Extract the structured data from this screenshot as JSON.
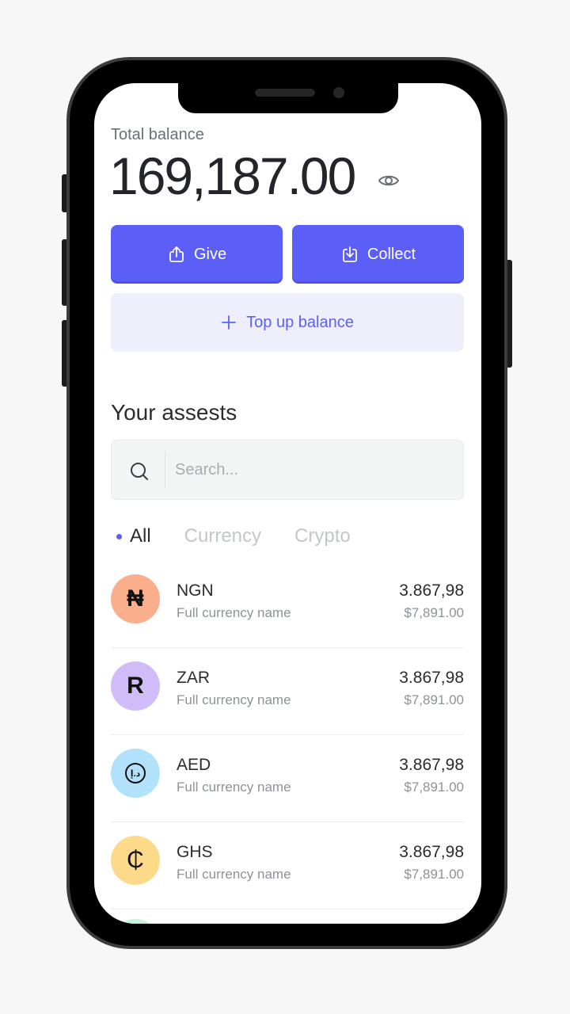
{
  "balance": {
    "label": "Total balance",
    "value": "169,187.00"
  },
  "actions": {
    "give_label": "Give",
    "collect_label": "Collect",
    "topup_label": "Top up balance"
  },
  "assets": {
    "title": "Your assests",
    "search_placeholder": "Search...",
    "tabs": [
      {
        "label": "All",
        "active": true
      },
      {
        "label": "Currency",
        "active": false
      },
      {
        "label": "Crypto",
        "active": false
      }
    ],
    "items": [
      {
        "symbol": "₦",
        "code": "NGN",
        "name": "Full currency name",
        "amount": "3.867,98",
        "usd": "$7,891.00",
        "color": "#fbae8c"
      },
      {
        "symbol": "R",
        "code": "ZAR",
        "name": "Full currency name",
        "amount": "3.867,98",
        "usd": "$7,891.00",
        "color": "#cfbcf9"
      },
      {
        "symbol": "د.إ",
        "code": "AED",
        "name": "Full currency name",
        "amount": "3.867,98",
        "usd": "$7,891.00",
        "color": "#b2e1fb"
      },
      {
        "symbol": "₵",
        "code": "GHS",
        "name": "Full currency name",
        "amount": "3.867,98",
        "usd": "$7,891.00",
        "color": "#fdd98a"
      }
    ]
  },
  "colors": {
    "accent": "#5b5ff8",
    "accent_light": "#efeffc"
  },
  "icons": {
    "visibility": "eye-icon",
    "give": "share-up-icon",
    "collect": "download-icon",
    "topup": "plus-icon",
    "search": "search-icon"
  }
}
